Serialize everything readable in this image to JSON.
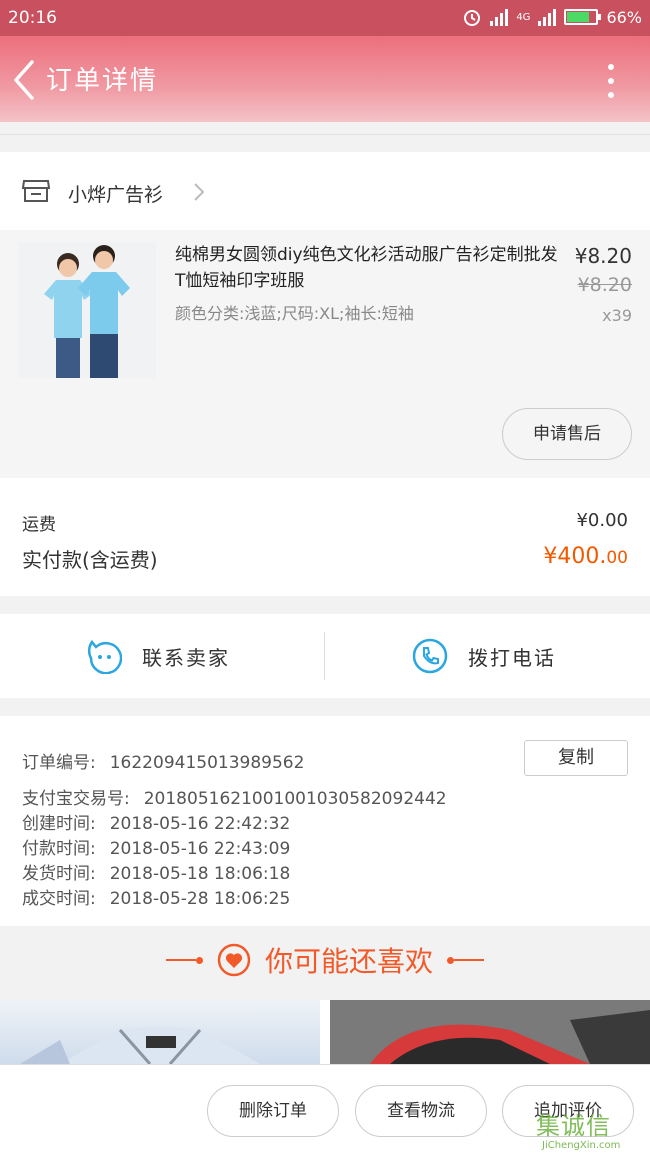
{
  "status_bar": {
    "time": "20:16",
    "network": "4G",
    "battery": "66%"
  },
  "header": {
    "title": "订单详情"
  },
  "shop": {
    "name": "小烨广告衫"
  },
  "item": {
    "title": "纯棉男女圆领diy纯色文化衫活动服广告衫定制批发T恤短袖印字班服",
    "sku": "颜色分类:浅蓝;尺码:XL;袖长:短袖",
    "price": "¥8.20",
    "original_price": "¥8.20",
    "quantity": "x39",
    "after_sale_label": "申请售后"
  },
  "fees": {
    "shipping_label": "运费",
    "shipping_value": "¥0.00",
    "paid_label": "实付款(含运费)",
    "paid_main": "¥400.",
    "paid_decimal": "00"
  },
  "contact": {
    "seller_label": "联系卖家",
    "call_label": "拨打电话"
  },
  "order_info": {
    "copy_label": "复制",
    "rows": [
      {
        "label": "订单编号:",
        "value": "162209415013989562"
      },
      {
        "label": "支付宝交易号:",
        "value": "2018051621001001030582092442"
      },
      {
        "label": "创建时间:",
        "value": "2018-05-16 22:42:32"
      },
      {
        "label": "付款时间:",
        "value": "2018-05-16 22:43:09"
      },
      {
        "label": "发货时间:",
        "value": "2018-05-18 18:06:18"
      },
      {
        "label": "成交时间:",
        "value": "2018-05-28 18:06:25"
      }
    ]
  },
  "recommend": {
    "title": "你可能还喜欢"
  },
  "actions": {
    "delete_label": "删除订单",
    "logistics_label": "查看物流",
    "review_label": "追加评价"
  },
  "watermark": {
    "text": "集诚信",
    "url_text": "JiChengXin.com"
  },
  "colors": {
    "accent": "#f25a00",
    "header": "#ec6f7c",
    "icon_blue": "#2aa6e0"
  }
}
